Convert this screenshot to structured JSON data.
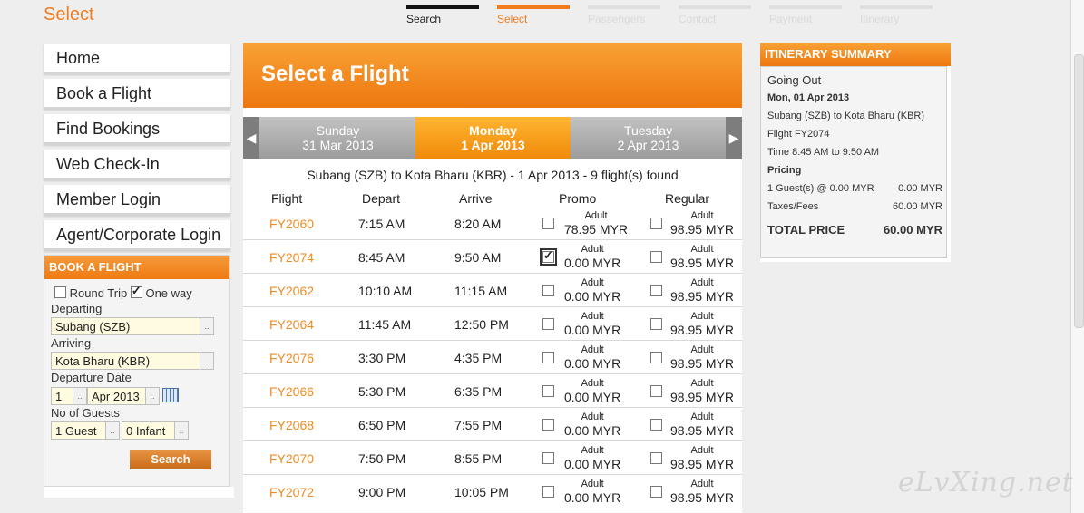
{
  "page_title": "Select",
  "steps": [
    {
      "label": "Search",
      "state": "done"
    },
    {
      "label": "Select",
      "state": "active"
    },
    {
      "label": "Passengers",
      "state": "pending"
    },
    {
      "label": "Contact",
      "state": "pending"
    },
    {
      "label": "Payment",
      "state": "pending"
    },
    {
      "label": "Itinerary",
      "state": "pending"
    }
  ],
  "nav": [
    "Home",
    "Book a Flight",
    "Find Bookings",
    "Web Check-In",
    "Member Login",
    "Agent/Corporate Login"
  ],
  "book": {
    "title": "BOOK A FLIGHT",
    "round_trip": "Round Trip",
    "one_way": "One way",
    "departing_label": "Departing",
    "departing_value": "Subang (SZB)",
    "arriving_label": "Arriving",
    "arriving_value": "Kota Bharu (KBR)",
    "date_label": "Departure Date",
    "day_value": "1",
    "month_value": "Apr 2013",
    "guests_label": "No of Guests",
    "guests_value": "1 Guest",
    "infant_value": "0 Infant",
    "search_label": "Search",
    "arrow_glyph": ".."
  },
  "main": {
    "title": "Select a Flight",
    "dates": [
      {
        "day": "Sunday",
        "date": "31 Mar 2013"
      },
      {
        "day": "Monday",
        "date": "1 Apr 2013"
      },
      {
        "day": "Tuesday",
        "date": "2 Apr 2013"
      }
    ],
    "found_text": "Subang (SZB) to Kota Bharu (KBR) - 1 Apr 2013 - 9 flight(s) found",
    "headers": {
      "flight": "Flight",
      "depart": "Depart",
      "arrive": "Arrive",
      "promo": "Promo",
      "regular": "Regular"
    },
    "flights": [
      {
        "no": "FY2060",
        "depart": "7:15 AM",
        "arrive": "8:20 AM",
        "promo_type": "Adult",
        "promo_price": "78.95 MYR",
        "promo_checked": false,
        "reg_type": "Adult",
        "reg_price": "98.95 MYR"
      },
      {
        "no": "FY2074",
        "depart": "8:45 AM",
        "arrive": "9:50 AM",
        "promo_type": "Adult",
        "promo_price": "0.00 MYR",
        "promo_checked": true,
        "reg_type": "Adult",
        "reg_price": "98.95 MYR"
      },
      {
        "no": "FY2062",
        "depart": "10:10 AM",
        "arrive": "11:15 AM",
        "promo_type": "Adult",
        "promo_price": "0.00 MYR",
        "promo_checked": false,
        "reg_type": "Adult",
        "reg_price": "98.95 MYR"
      },
      {
        "no": "FY2064",
        "depart": "11:45 AM",
        "arrive": "12:50 PM",
        "promo_type": "Adult",
        "promo_price": "0.00 MYR",
        "promo_checked": false,
        "reg_type": "Adult",
        "reg_price": "98.95 MYR"
      },
      {
        "no": "FY2076",
        "depart": "3:30 PM",
        "arrive": "4:35 PM",
        "promo_type": "Adult",
        "promo_price": "0.00 MYR",
        "promo_checked": false,
        "reg_type": "Adult",
        "reg_price": "98.95 MYR"
      },
      {
        "no": "FY2066",
        "depart": "5:30 PM",
        "arrive": "6:35 PM",
        "promo_type": "Adult",
        "promo_price": "0.00 MYR",
        "promo_checked": false,
        "reg_type": "Adult",
        "reg_price": "98.95 MYR"
      },
      {
        "no": "FY2068",
        "depart": "6:50 PM",
        "arrive": "7:55 PM",
        "promo_type": "Adult",
        "promo_price": "0.00 MYR",
        "promo_checked": false,
        "reg_type": "Adult",
        "reg_price": "98.95 MYR"
      },
      {
        "no": "FY2070",
        "depart": "7:50 PM",
        "arrive": "8:55 PM",
        "promo_type": "Adult",
        "promo_price": "0.00 MYR",
        "promo_checked": false,
        "reg_type": "Adult",
        "reg_price": "98.95 MYR"
      },
      {
        "no": "FY2072",
        "depart": "9:00 PM",
        "arrive": "10:05 PM",
        "promo_type": "Adult",
        "promo_price": "0.00 MYR",
        "promo_checked": false,
        "reg_type": "Adult",
        "reg_price": "98.95 MYR"
      }
    ]
  },
  "itinerary": {
    "title": "ITINERARY SUMMARY",
    "going_out": "Going Out",
    "date": "Mon, 01 Apr 2013",
    "route": "Subang (SZB) to Kota Bharu (KBR)",
    "flight": "Flight FY2074",
    "time": "Time 8:45 AM to 9:50 AM",
    "pricing_label": "Pricing",
    "guest_line": "1 Guest(s) @ 0.00 MYR",
    "guest_amount": "0.00 MYR",
    "taxes_label": "Taxes/Fees",
    "taxes_amount": "60.00 MYR",
    "total_label": "TOTAL PRICE",
    "total_amount": "60.00 MYR"
  },
  "watermark": "eLvXing.net",
  "colors": {
    "accent": "#f07c1e",
    "flight_link": "#f08a24"
  }
}
